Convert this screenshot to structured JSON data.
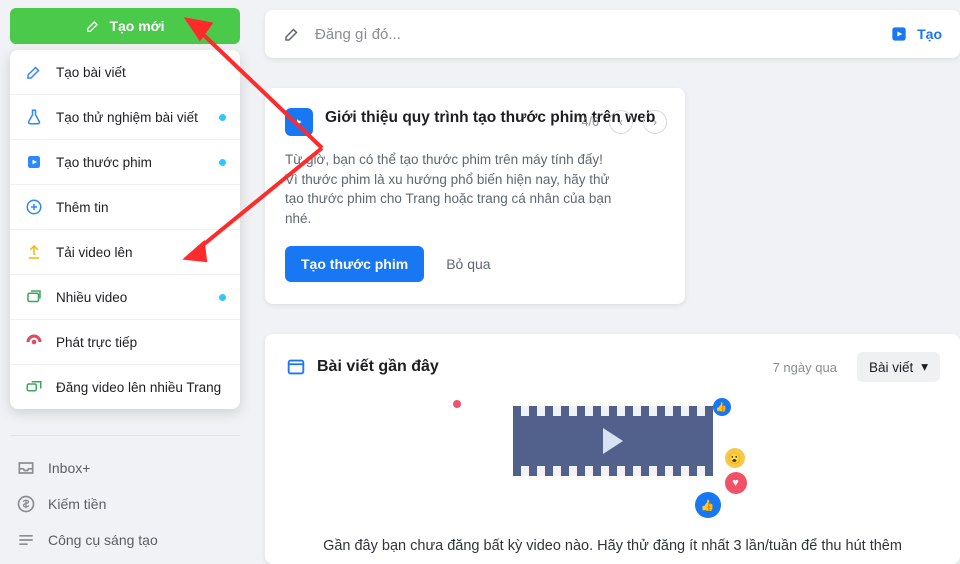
{
  "sidebar": {
    "create_button": "Tạo mới",
    "menu": [
      {
        "label": "Tạo bài viết",
        "dot": false
      },
      {
        "label": "Tạo thử nghiệm bài viết",
        "dot": true
      },
      {
        "label": "Tạo thước phim",
        "dot": true
      },
      {
        "label": "Thêm tin",
        "dot": false
      },
      {
        "label": "Tải video lên",
        "dot": false
      },
      {
        "label": "Nhiều video",
        "dot": true
      },
      {
        "label": "Phát trực tiếp",
        "dot": false
      },
      {
        "label": "Đăng video lên nhiều Trang",
        "dot": false
      }
    ],
    "secondary": [
      "Inbox+",
      "Kiếm tiền",
      "Công cụ sáng tạo"
    ]
  },
  "composer": {
    "placeholder": "Đăng gì đó...",
    "right_action": "Tạo"
  },
  "intro_card": {
    "title": "Giới thiệu quy trình tạo thước phim trên web",
    "counter": "4/6",
    "body": "Từ giờ, bạn có thể tạo thước phim trên máy tính đấy! Vì thước phim là xu hướng phổ biến hiện nay, hãy thử tạo thước phim cho Trang hoặc trang cá nhân của bạn nhé.",
    "primary_btn": "Tạo thước phim",
    "skip": "Bỏ qua"
  },
  "recent": {
    "title": "Bài viết gần đây",
    "range": "7 ngày qua",
    "filter": "Bài viết",
    "empty_msg": "Gần đây bạn chưa đăng bất kỳ video nào. Hãy thử đăng ít nhất 3 lần/tuần để thu hút thêm"
  }
}
